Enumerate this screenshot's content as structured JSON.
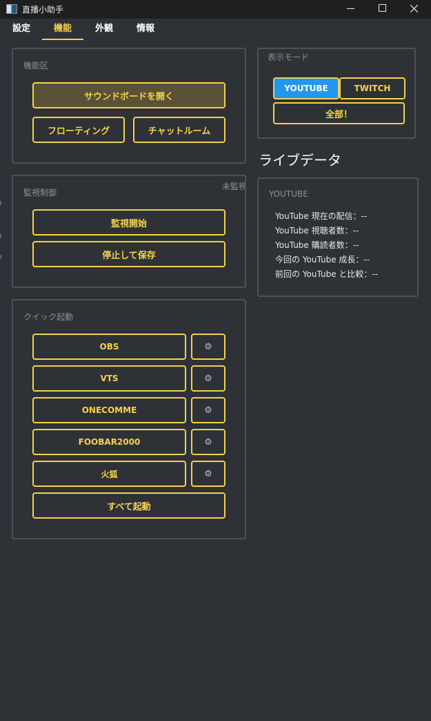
{
  "window": {
    "title": "直播小助手",
    "close_symbol": "✕"
  },
  "tabs": [
    {
      "label": "設定",
      "active": false
    },
    {
      "label": "機能",
      "active": true
    },
    {
      "label": "外観",
      "active": false
    },
    {
      "label": "情報",
      "active": false
    }
  ],
  "feature_group": {
    "title": "機能区",
    "soundboard_button": "サウンドボードを開く",
    "floating_button": "フローティング",
    "chatroom_button": "チャットルーム"
  },
  "monitor_group": {
    "title": "監視制御",
    "status": "未監視",
    "start_button": "監視開始",
    "stop_save_button": "停止して保存"
  },
  "quick_launch_group": {
    "title": "クイック起動",
    "apps": [
      {
        "label": "OBS",
        "settings_icon": "gear-icon"
      },
      {
        "label": "VTS",
        "settings_icon": "gear-icon"
      },
      {
        "label": "ONECOMME",
        "settings_icon": "gear-icon"
      },
      {
        "label": "FOOBAR2000",
        "settings_icon": "gear-icon"
      },
      {
        "label": "火狐",
        "settings_icon": "gear-icon"
      }
    ],
    "gear_glyph": "⚙",
    "launch_all_button": "すべて起動"
  },
  "display_mode_group": {
    "title": "表示モード",
    "youtube_button": "YOUTUBE",
    "twitch_button": "TWITCH",
    "all_button": "全部！",
    "selected": "YOUTUBE"
  },
  "live_data": {
    "heading": "ライブデータ",
    "panel_title": "YOUTUBE",
    "lines": [
      "YouTube 現在の配信：--",
      "YouTube 視聴者数：--",
      "YouTube 購読者数：--",
      "今回の YouTube 成長：--",
      "前回の YouTube と比較：--"
    ]
  },
  "colors": {
    "accent": "#f6d24a",
    "selected_mode": "#2196f3",
    "background": "#2e3236",
    "group_border": "#4c5257"
  }
}
